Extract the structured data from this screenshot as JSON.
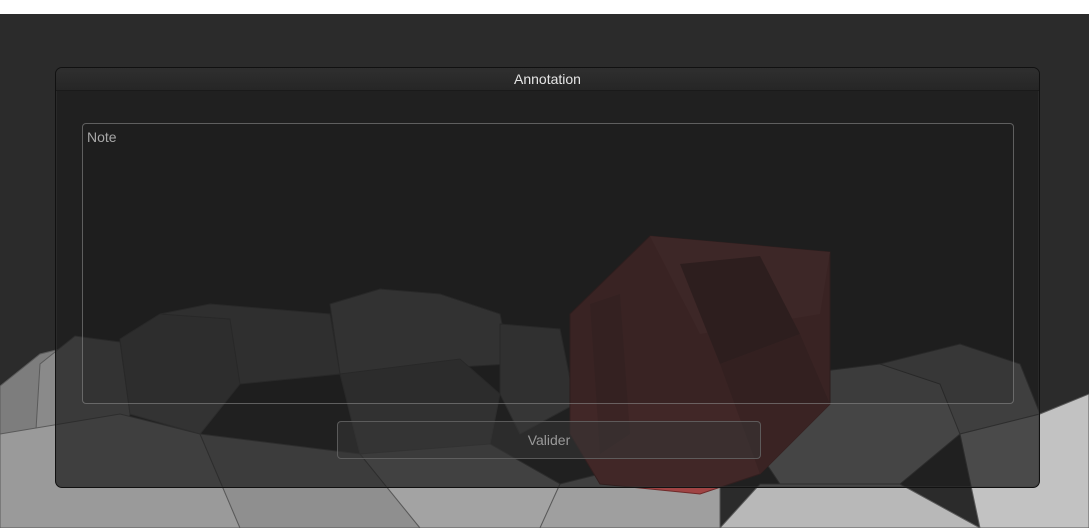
{
  "dialog": {
    "title": "Annotation",
    "note_placeholder": "Note",
    "note_value": "",
    "validate_label": "Valider"
  },
  "scene": {
    "description_colors": {
      "background": "#2b2b2b",
      "buildings": "#8c8c8c",
      "highlighted_building": "#b04848"
    }
  }
}
